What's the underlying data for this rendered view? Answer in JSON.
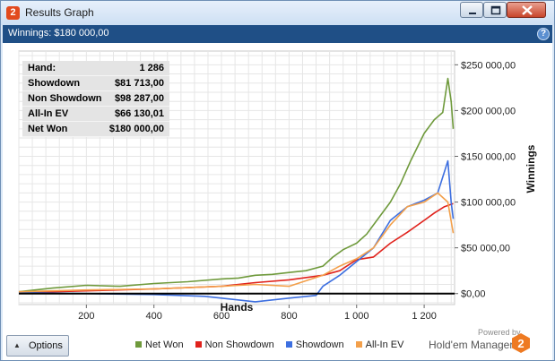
{
  "window": {
    "title": "Results Graph",
    "icon_label": "2",
    "colors": {
      "header_bg": "#1f4f86",
      "close_button": "#c8452b"
    }
  },
  "header": {
    "title": "Winnings: $180 000,00",
    "help_label": "?"
  },
  "stats": [
    {
      "label": "Hand:",
      "value": "1 286"
    },
    {
      "label": "Showdown",
      "value": "$81 713,00"
    },
    {
      "label": "Non Showdown",
      "value": "$98 287,00"
    },
    {
      "label": "All-In EV",
      "value": "$66 130,01"
    },
    {
      "label": "Net Won",
      "value": "$180 000,00"
    }
  ],
  "footer": {
    "options_label": "Options",
    "powered_by": "Powered by",
    "brand": "Hold'em Manager",
    "brand_logo_label": "2"
  },
  "chart_data": {
    "type": "line",
    "xlabel": "Hands",
    "ylabel": "Winnings",
    "xlim": [
      0,
      1290
    ],
    "ylim": [
      -12000,
      265000
    ],
    "x_ticks": [
      200,
      400,
      600,
      800,
      1000,
      1200
    ],
    "x_tick_labels": [
      "200",
      "400",
      "600",
      "800",
      "1 000",
      "1 200"
    ],
    "y_ticks": [
      0,
      50000,
      100000,
      150000,
      200000,
      250000
    ],
    "y_tick_labels": [
      "$0,00",
      "$50 000,00",
      "$100 000,00",
      "$150 000,00",
      "$200 000,00",
      "$250 000,00"
    ],
    "grid": true,
    "legend_position": "bottom",
    "zero_line": true,
    "series": [
      {
        "name": "Net Won",
        "color": "#6f9a3c",
        "x": [
          0,
          100,
          200,
          300,
          400,
          500,
          600,
          650,
          700,
          750,
          800,
          850,
          900,
          930,
          960,
          1000,
          1030,
          1060,
          1100,
          1130,
          1160,
          1200,
          1230,
          1255,
          1270,
          1280,
          1286
        ],
        "y": [
          2000,
          6000,
          9000,
          8000,
          11000,
          13000,
          16000,
          17000,
          20000,
          21000,
          23000,
          25000,
          30000,
          40000,
          48000,
          55000,
          65000,
          80000,
          100000,
          120000,
          145000,
          175000,
          190000,
          198000,
          235000,
          210000,
          180000
        ]
      },
      {
        "name": "Non Showdown",
        "color": "#e0221c",
        "x": [
          0,
          200,
          400,
          600,
          700,
          800,
          900,
          950,
          1000,
          1050,
          1100,
          1150,
          1200,
          1230,
          1260,
          1286
        ],
        "y": [
          1000,
          3000,
          5000,
          8000,
          12000,
          15000,
          20000,
          25000,
          37000,
          40000,
          55000,
          67000,
          80000,
          88000,
          95000,
          98287
        ]
      },
      {
        "name": "Showdown",
        "color": "#3d6fe0",
        "x": [
          0,
          200,
          400,
          550,
          600,
          700,
          800,
          880,
          900,
          950,
          1000,
          1050,
          1100,
          1150,
          1200,
          1240,
          1270,
          1280,
          1286
        ],
        "y": [
          1000,
          0,
          -1000,
          -3000,
          -5000,
          -9000,
          -5000,
          -2000,
          8000,
          20000,
          35000,
          50000,
          80000,
          95000,
          102000,
          110000,
          145000,
          100000,
          81713
        ]
      },
      {
        "name": "All-In EV",
        "color": "#f3a04b",
        "x": [
          0,
          200,
          400,
          600,
          700,
          800,
          900,
          950,
          1000,
          1050,
          1100,
          1150,
          1200,
          1240,
          1270,
          1286
        ],
        "y": [
          2000,
          4000,
          5000,
          8000,
          10000,
          8000,
          20000,
          30000,
          38000,
          50000,
          75000,
          95000,
          100000,
          110000,
          100000,
          66130
        ]
      }
    ]
  }
}
